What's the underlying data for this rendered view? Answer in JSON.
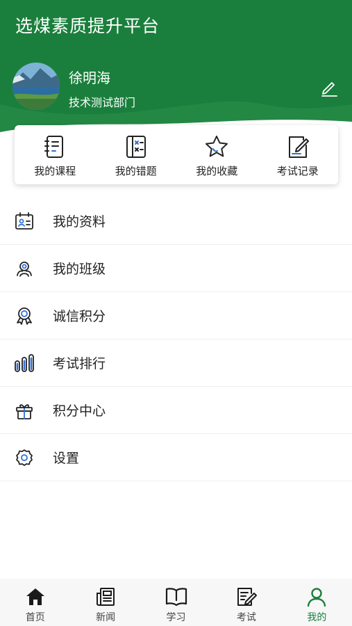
{
  "header": {
    "title": "选煤素质提升平台",
    "user_name": "徐明海",
    "department": "技术测试部门"
  },
  "quick_actions": [
    {
      "label": "我的课程",
      "icon": "course-book-icon"
    },
    {
      "label": "我的错题",
      "icon": "wrong-questions-icon"
    },
    {
      "label": "我的收藏",
      "icon": "star-icon"
    },
    {
      "label": "考试记录",
      "icon": "exam-record-icon"
    }
  ],
  "menu": [
    {
      "label": "我的资料",
      "icon": "profile-card-icon"
    },
    {
      "label": "我的班级",
      "icon": "class-group-icon"
    },
    {
      "label": "诚信积分",
      "icon": "award-badge-icon"
    },
    {
      "label": "考试排行",
      "icon": "ranking-bars-icon"
    },
    {
      "label": "积分中心",
      "icon": "gift-icon"
    },
    {
      "label": "设置",
      "icon": "settings-gear-icon"
    }
  ],
  "tabs": [
    {
      "label": "首页",
      "icon": "home-icon"
    },
    {
      "label": "新闻",
      "icon": "news-icon"
    },
    {
      "label": "学习",
      "icon": "study-book-icon"
    },
    {
      "label": "考试",
      "icon": "exam-icon"
    },
    {
      "label": "我的",
      "icon": "user-icon",
      "active": true
    }
  ],
  "colors": {
    "brand": "#1a7f3c",
    "accent_blue": "#2f6fd6",
    "text": "#222222"
  }
}
